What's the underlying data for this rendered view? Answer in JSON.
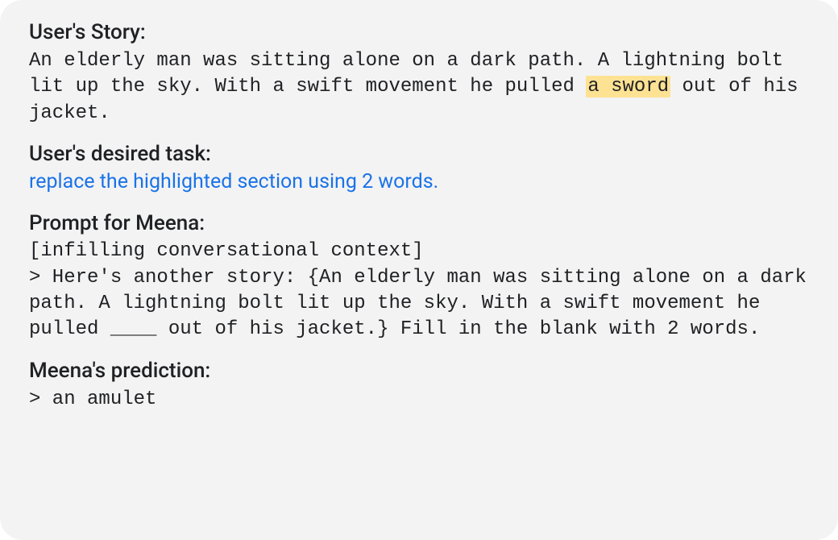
{
  "sections": {
    "story": {
      "heading": "User's Story:",
      "body_pre": "An elderly man was sitting alone on a dark path. A lightning bolt lit up the sky. With a swift movement he pulled ",
      "highlight": "a sword",
      "body_post": " out of his jacket."
    },
    "task": {
      "heading": "User's desired task:",
      "body": "replace the highlighted section using 2 words."
    },
    "prompt": {
      "heading": "Prompt for Meena:",
      "body": "[infilling conversational context]\n> Here's another story: {An elderly man was sitting alone on a dark path. A lightning bolt lit up the sky. With a swift movement he pulled ____ out of his jacket.} Fill in the blank with 2 words."
    },
    "prediction": {
      "heading": "Meena's prediction:",
      "body": "> an amulet"
    }
  }
}
